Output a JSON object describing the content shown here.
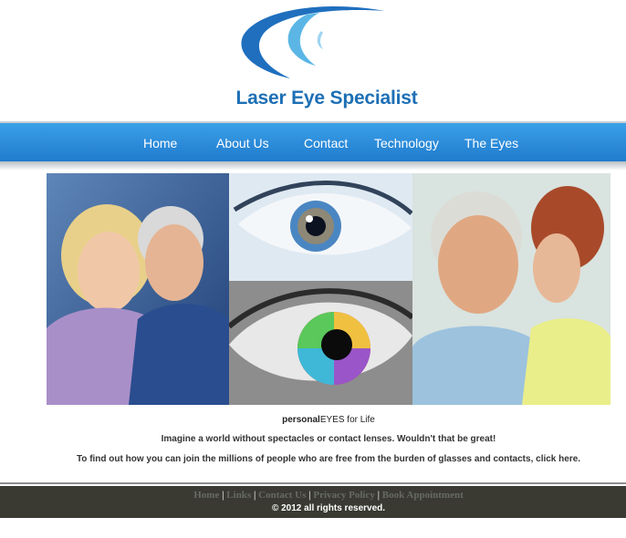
{
  "brand": {
    "name": "Laser Eye Specialist",
    "color": "#1d6fb5"
  },
  "nav": {
    "items": [
      {
        "label": "Home"
      },
      {
        "label": "About Us"
      },
      {
        "label": "Contact"
      },
      {
        "label": "Technology"
      },
      {
        "label": "The Eyes"
      }
    ],
    "bar_color": "#2f8fdc"
  },
  "photos": [
    {
      "name": "smiling-couple-photo"
    },
    {
      "name": "blue-eye-closeup-photo"
    },
    {
      "name": "rainbow-iris-photo"
    },
    {
      "name": "kissing-couple-photo"
    }
  ],
  "content": {
    "caption_bold": "personal",
    "caption_rest": "EYES for Life",
    "line1": "Imagine a world without spectacles or contact lenses. Wouldn't that be great!",
    "line2": "To find out how you can join the millions of people who are free from the burden of glasses and contacts, click here."
  },
  "footer": {
    "links": [
      "Home",
      "Links",
      "Contact Us",
      "Privacy Policy",
      "Book Appointment"
    ],
    "separator": "|",
    "copyright": "© 2012 all rights reserved.",
    "bg_color": "#3a3a33"
  }
}
